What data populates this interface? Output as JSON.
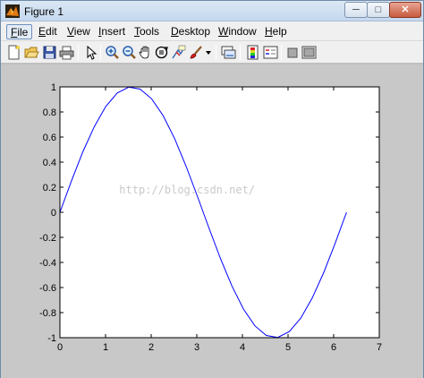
{
  "window": {
    "title": "Figure 1",
    "minimize_glyph": "─",
    "maximize_glyph": "□",
    "close_glyph": "✕"
  },
  "menu": [
    {
      "label": "File",
      "underline": "F"
    },
    {
      "label": "Edit",
      "underline": "E"
    },
    {
      "label": "View",
      "underline": "V"
    },
    {
      "label": "Insert",
      "underline": "I"
    },
    {
      "label": "Tools",
      "underline": "T"
    },
    {
      "label": "Desktop",
      "underline": "D"
    },
    {
      "label": "Window",
      "underline": "W"
    },
    {
      "label": "Help",
      "underline": "H"
    }
  ],
  "toolbar_icons": [
    "new-figure-icon",
    "open-file-icon",
    "save-icon",
    "print-icon",
    "edit-plot-arrow-icon",
    "zoom-in-icon",
    "zoom-out-icon",
    "pan-icon",
    "rotate-3d-icon",
    "data-cursor-icon",
    "brush-icon",
    "brush-dropdown-icon",
    "link-plot-icon",
    "insert-colorbar-icon",
    "insert-legend-icon",
    "hide-plot-tools-icon",
    "show-plot-tools-icon"
  ],
  "colors": {
    "line": "#0000ff",
    "axes_bg": "#ffffff",
    "figure_bg": "#c8c8c8"
  },
  "watermark": "http://blog.csdn.net/",
  "chart_data": {
    "type": "line",
    "title": "",
    "xlabel": "",
    "ylabel": "",
    "xlim": [
      0,
      7
    ],
    "ylim": [
      -1,
      1
    ],
    "xticks": [
      "0",
      "1",
      "2",
      "3",
      "4",
      "5",
      "6",
      "7"
    ],
    "yticks": [
      "-1",
      "-0.8",
      "-0.6",
      "-0.4",
      "-0.2",
      "0",
      "0.2",
      "0.4",
      "0.6",
      "0.8",
      "1"
    ],
    "grid": false,
    "series": [
      {
        "x": [
          0,
          0.2513,
          0.5027,
          0.754,
          1.0053,
          1.2566,
          1.508,
          1.7593,
          2.0106,
          2.2619,
          2.5133,
          2.7646,
          3.0159,
          3.2673,
          3.5186,
          3.7699,
          4.0212,
          4.2726,
          4.5239,
          4.7752,
          5.0265,
          5.2779,
          5.5292,
          5.7805,
          6.0319,
          6.2832
        ],
        "y": [
          0,
          0.2487,
          0.4818,
          0.6845,
          0.8443,
          0.9511,
          0.998,
          0.9823,
          0.9048,
          0.7705,
          0.5878,
          0.3681,
          0.1253,
          -0.1253,
          -0.3681,
          -0.5878,
          -0.7705,
          -0.9048,
          -0.9823,
          -0.998,
          -0.9511,
          -0.8443,
          -0.6845,
          -0.4818,
          -0.2487,
          0
        ]
      }
    ]
  }
}
